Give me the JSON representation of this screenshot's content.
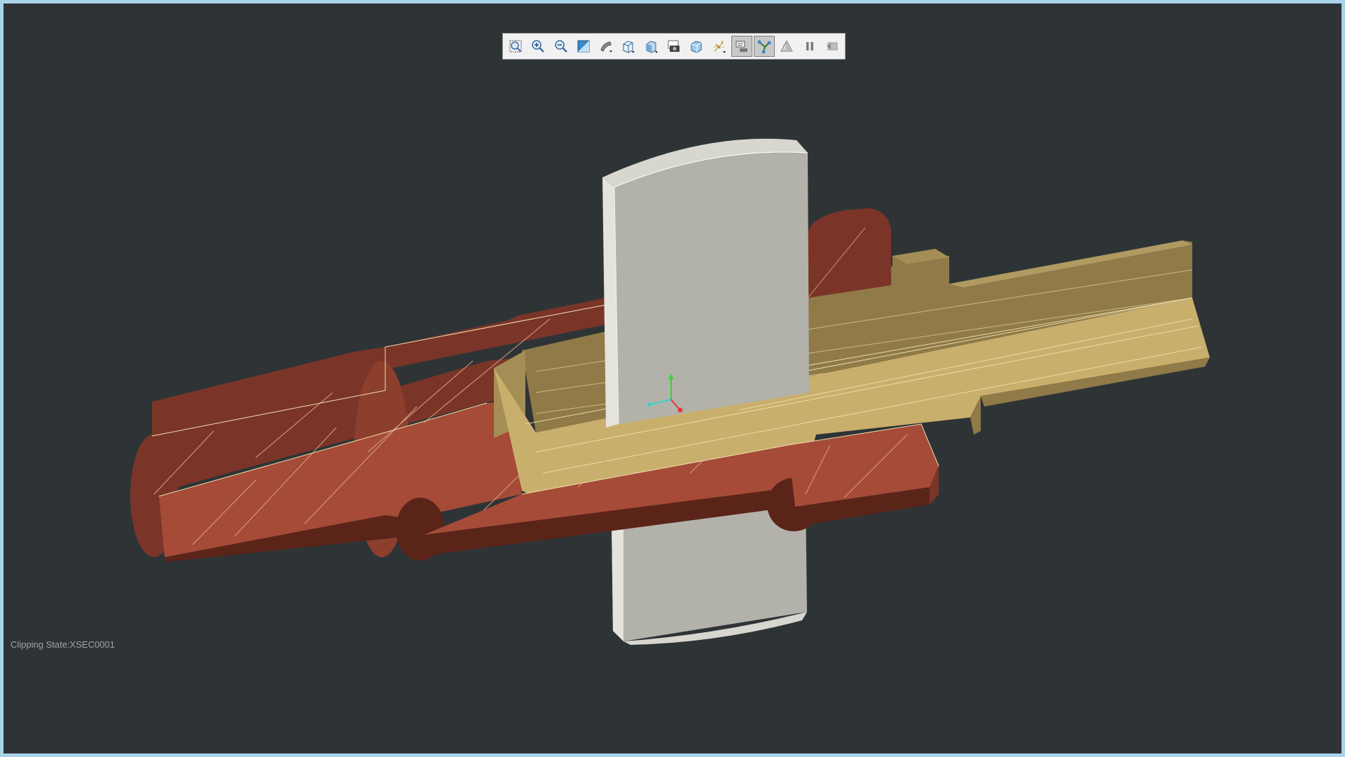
{
  "viewer": {
    "clip_state_label": "Clipping State:XSEC0001",
    "colors": {
      "background": "#2e3436",
      "frame": "#a9d3ea",
      "copper_face": "#a54b38",
      "copper_dark": "#7a3528",
      "brass_light": "#c9af6c",
      "brass_dark": "#8f7a48",
      "plate": "#b3b2aa"
    }
  },
  "toolbar": {
    "buttons": [
      {
        "name": "zoom-fit-button",
        "icon": "zoom-fit-icon",
        "active": false
      },
      {
        "name": "zoom-in-button",
        "icon": "zoom-in-icon",
        "active": false
      },
      {
        "name": "zoom-out-button",
        "icon": "zoom-out-icon",
        "active": false
      },
      {
        "name": "refit-button",
        "icon": "refit-icon",
        "active": false
      },
      {
        "name": "display-style-button",
        "icon": "display-style-icon",
        "active": false
      },
      {
        "name": "saved-views-button",
        "icon": "cube-view-icon",
        "active": false
      },
      {
        "name": "view-manager-button",
        "icon": "view-manager-icon",
        "active": false
      },
      {
        "name": "screenshot-button",
        "icon": "camera-icon",
        "active": false
      },
      {
        "name": "spin-center-button",
        "icon": "spin-cube-icon",
        "active": false
      },
      {
        "name": "datum-display-button",
        "icon": "datum-icon",
        "active": false
      },
      {
        "name": "annotation-display-button",
        "icon": "annotation-display-icon",
        "active": true
      },
      {
        "name": "clipping-button",
        "icon": "clipping-icon",
        "active": true
      },
      {
        "name": "perspective-button",
        "icon": "perspective-icon",
        "active": false
      },
      {
        "name": "pause-button",
        "icon": "pause-icon",
        "active": false
      },
      {
        "name": "exit-button",
        "icon": "exit-icon",
        "active": false
      }
    ]
  }
}
